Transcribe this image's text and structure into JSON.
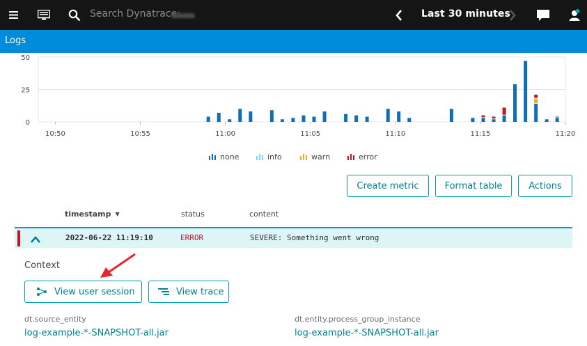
{
  "topbar": {
    "search_placeholder": "Search Dynatrace:",
    "timeframe": "Last 30 minutes",
    "icons": [
      "menu-icon",
      "monitor-icon",
      "search-icon",
      "chevron-left-icon",
      "chevron-right-icon",
      "chat-icon",
      "user-icon"
    ]
  },
  "page": {
    "title": "Logs"
  },
  "chart_data": {
    "type": "bar",
    "stacked": true,
    "yticks": [
      "50",
      "25",
      "0"
    ],
    "ylim": [
      0,
      50
    ],
    "xticks": [
      "10:50",
      "10:55",
      "11:00",
      "11:05",
      "11:10",
      "11:15",
      "11:20"
    ],
    "x_range": [
      "10:49",
      "11:20"
    ],
    "x": [
      "10:59:00",
      "10:59:37",
      "11:00:15",
      "11:00:52",
      "11:01:29",
      "11:02:07",
      "11:02:44",
      "11:03:21",
      "11:03:59",
      "11:04:36",
      "11:05:13",
      "11:05:50",
      "11:06:28",
      "11:07:05",
      "11:07:42",
      "11:08:20",
      "11:08:57",
      "11:09:34",
      "11:10:12",
      "11:10:49",
      "11:11:26",
      "11:12:03",
      "11:13:18",
      "11:13:55",
      "11:14:33",
      "11:15:10",
      "11:15:47",
      "11:16:24",
      "11:17:02",
      "11:17:39",
      "11:18:16",
      "11:18:54",
      "11:19:31",
      "11:20:08"
    ],
    "series": [
      {
        "name": "none",
        "color": "#0f6eb5",
        "values": [
          4,
          7,
          2,
          10,
          8,
          0,
          9,
          2,
          3,
          5,
          4,
          8,
          0,
          6,
          5,
          4,
          0,
          10,
          8,
          3,
          0,
          0,
          10,
          0,
          3,
          3,
          2,
          5,
          29,
          47,
          14,
          2,
          3,
          0
        ]
      },
      {
        "name": "info",
        "color": "#7dd6f1",
        "values": [
          0,
          0,
          0,
          0,
          0,
          0,
          0,
          0,
          0,
          0,
          0,
          0,
          0,
          0,
          0,
          0,
          0,
          0,
          0,
          0,
          0,
          0,
          0,
          0,
          0,
          0,
          0,
          0,
          0,
          0,
          0,
          0,
          0,
          0
        ]
      },
      {
        "name": "warn",
        "color": "#e3b41c",
        "values": [
          0,
          0,
          0,
          0,
          0,
          0,
          0,
          0,
          0,
          0,
          0,
          0,
          0,
          0,
          0,
          0,
          0,
          0,
          0,
          0,
          0,
          0,
          0,
          0,
          0,
          0,
          0,
          0,
          0,
          0,
          4,
          0,
          0,
          0
        ]
      },
      {
        "name": "error",
        "color": "#c41425",
        "values": [
          0,
          0,
          0,
          0,
          0,
          0,
          0,
          0,
          0,
          0,
          0,
          0,
          0,
          0,
          0,
          0,
          0,
          0,
          0,
          0,
          0,
          0,
          0,
          0,
          0,
          2,
          2,
          6,
          0,
          0,
          3,
          0,
          1,
          0
        ]
      }
    ],
    "grid": true,
    "legend_position": "bottom"
  },
  "actions": {
    "create_metric": "Create metric",
    "format_table": "Format table",
    "actions": "Actions"
  },
  "table": {
    "columns": [
      "timestamp",
      "status",
      "content"
    ],
    "sort_indicator": "▼",
    "row": {
      "timestamp": "2022-06-22 11:19:10",
      "status": "ERROR",
      "content": "SEVERE: Something went wrong"
    }
  },
  "context": {
    "title": "Context",
    "view_user_session": "View user session",
    "view_trace": "View trace",
    "fields": [
      {
        "key": "dt.source_entity",
        "value": "log-example-*-SNAPSHOT-all.jar"
      },
      {
        "key": "dt.entity.process_group_instance",
        "value": "log-example-*-SNAPSHOT-all.jar"
      }
    ]
  },
  "colors": {
    "accent": "#00a1b2",
    "link": "#00848e",
    "header": "#008cdb",
    "error": "#c41425",
    "topbar": "#151515"
  }
}
